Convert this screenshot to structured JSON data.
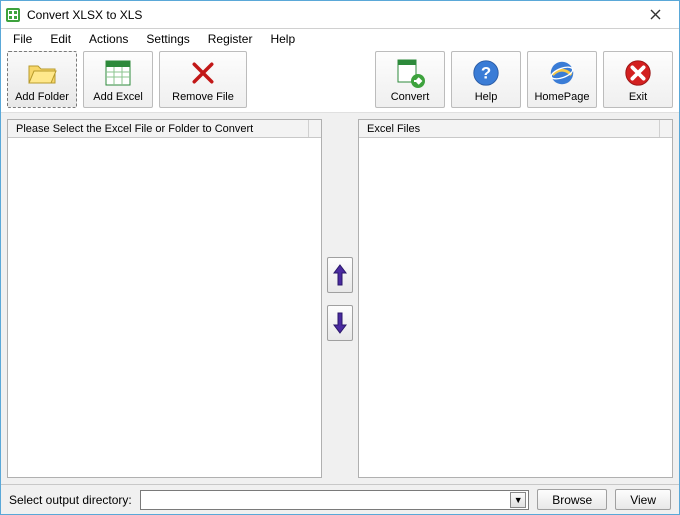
{
  "window": {
    "title": "Convert XLSX to XLS"
  },
  "menu": {
    "file": "File",
    "edit": "Edit",
    "actions": "Actions",
    "settings": "Settings",
    "register": "Register",
    "help": "Help"
  },
  "toolbar": {
    "add_folder": "Add Folder",
    "add_excel": "Add Excel",
    "remove_file": "Remove File",
    "convert": "Convert",
    "help": "Help",
    "homepage": "HomePage",
    "exit": "Exit"
  },
  "panels": {
    "left_header": "Please Select the Excel File or Folder to Convert",
    "right_header": "Excel Files"
  },
  "bottom": {
    "label": "Select  output directory:",
    "value": "",
    "browse": "Browse",
    "view": "View"
  }
}
